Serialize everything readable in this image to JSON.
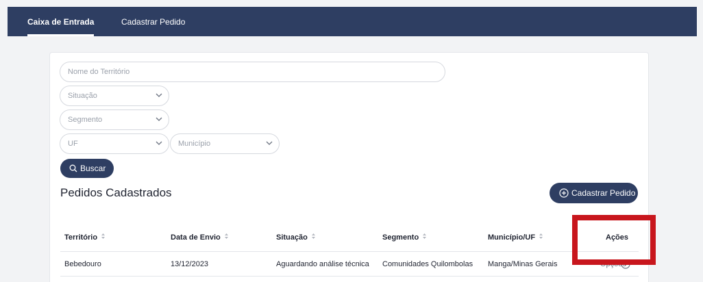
{
  "nav": {
    "tabs": [
      {
        "label": "Caixa de Entrada",
        "active": true
      },
      {
        "label": "Cadastrar Pedido",
        "active": false
      }
    ]
  },
  "filters": {
    "territorio_placeholder": "Nome do Território",
    "situacao_placeholder": "Situação",
    "segmento_placeholder": "Segmento",
    "uf_placeholder": "UF",
    "municipio_placeholder": "Município",
    "search_label": "Buscar"
  },
  "section": {
    "title": "Pedidos Cadastrados",
    "add_button_label": "Cadastrar Pedido"
  },
  "table": {
    "headers": [
      "Território",
      "Data de Envio",
      "Situação",
      "Segmento",
      "Município/UF",
      "Ações"
    ],
    "rows": [
      {
        "territorio": "Bebedouro",
        "data_envio": "13/12/2023",
        "situacao": "Aguardando análise técnica",
        "segmento": "Comunidades Quilombolas",
        "municipio_uf": "Manga/Minas Gerais",
        "acoes": "Opções"
      }
    ]
  },
  "colors": {
    "navbar": "#2e3e62",
    "primary_button": "#2e3e62",
    "highlight_box": "#c8161d"
  }
}
